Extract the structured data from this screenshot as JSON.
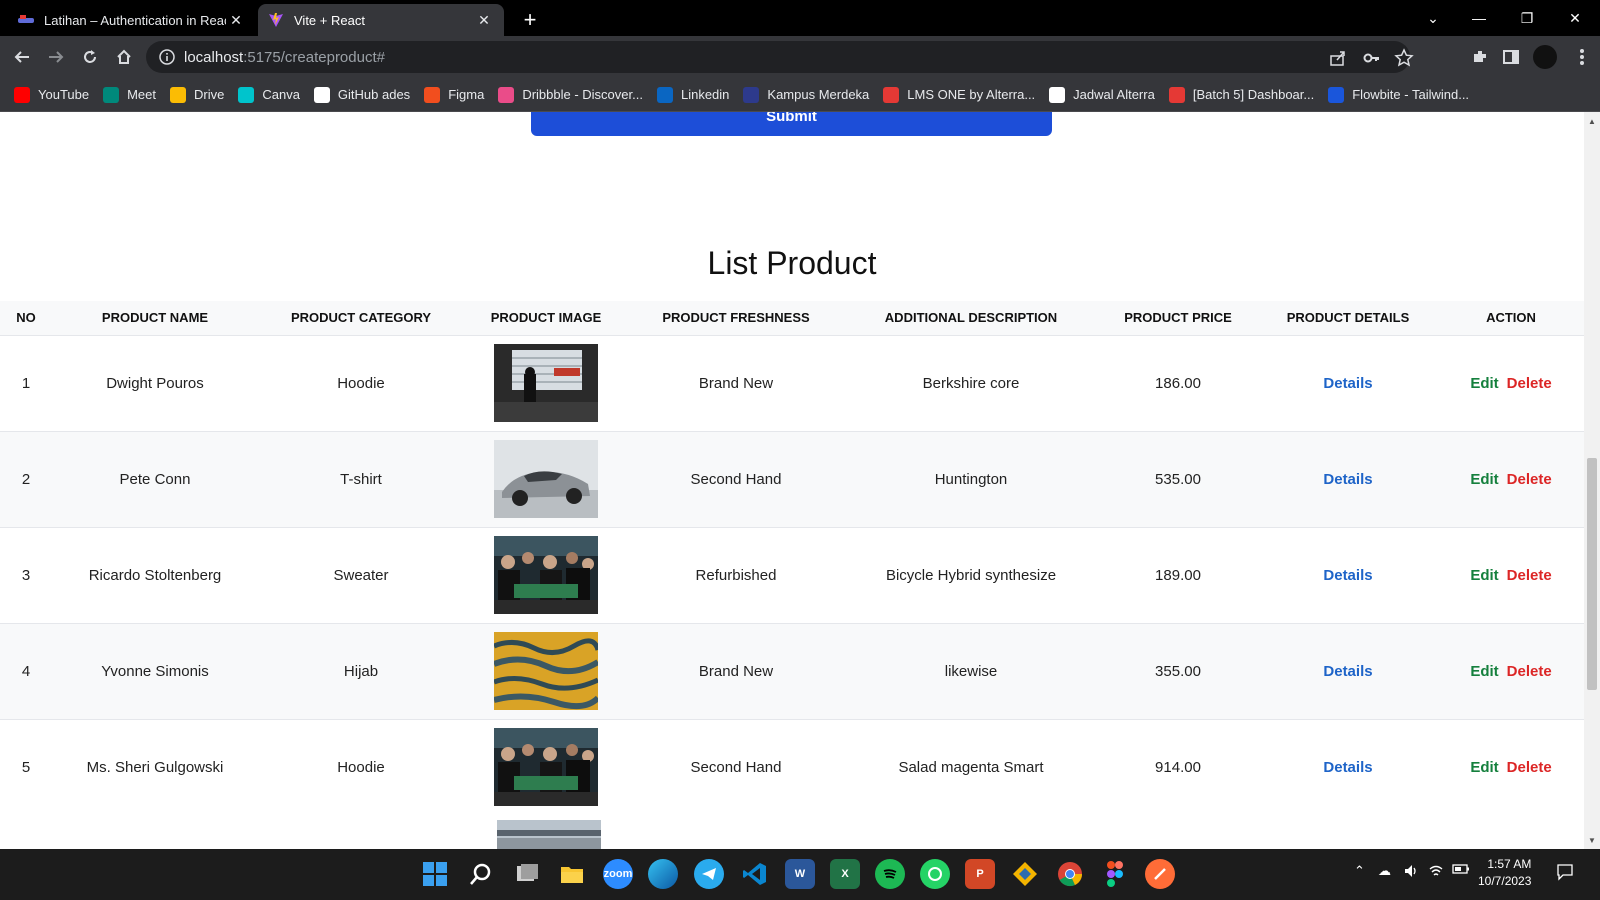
{
  "browser": {
    "tabs": [
      {
        "title": "Latihan – Authentication in React",
        "active": false
      },
      {
        "title": "Vite + React",
        "active": true
      }
    ],
    "url_host": "localhost",
    "url_path": ":5175/createproduct#",
    "bookmarks": [
      {
        "label": "YouTube",
        "icon": "youtube-icon",
        "color": "#ff0000"
      },
      {
        "label": "Meet",
        "icon": "meet-icon",
        "color": "#00897b"
      },
      {
        "label": "Drive",
        "icon": "drive-icon",
        "color": "#fbbc04"
      },
      {
        "label": "Canva",
        "icon": "canva-icon",
        "color": "#00c4cc"
      },
      {
        "label": "GitHub ades",
        "icon": "github-icon",
        "color": "#ffffff"
      },
      {
        "label": "Figma",
        "icon": "figma-icon",
        "color": "#f24e1e"
      },
      {
        "label": "Dribbble - Discover...",
        "icon": "dribbble-icon",
        "color": "#ea4c89"
      },
      {
        "label": "Linkedin",
        "icon": "linkedin-icon",
        "color": "#0a66c2"
      },
      {
        "label": "Kampus Merdeka",
        "icon": "kampus-merdeka-icon",
        "color": "#2d3a8c"
      },
      {
        "label": "LMS ONE by Alterra...",
        "icon": "lms-icon",
        "color": "#e53935"
      },
      {
        "label": "Jadwal Alterra",
        "icon": "notion-icon",
        "color": "#ffffff"
      },
      {
        "label": "[Batch 5] Dashboar...",
        "icon": "pin-icon",
        "color": "#e53935"
      },
      {
        "label": "Flowbite - Tailwind...",
        "icon": "flowbite-icon",
        "color": "#1a56db"
      }
    ]
  },
  "page": {
    "submit_label": "Submit",
    "list_title": "List Product",
    "columns": [
      "NO",
      "PRODUCT NAME",
      "PRODUCT CATEGORY",
      "PRODUCT IMAGE",
      "PRODUCT FRESHNESS",
      "ADDITIONAL DESCRIPTION",
      "PRODUCT PRICE",
      "PRODUCT DETAILS",
      "ACTION"
    ],
    "rows": [
      {
        "no": "1",
        "name": "Dwight Pouros",
        "category": "Hoodie",
        "image": "window-room-photo",
        "freshness": "Brand New",
        "description": "Berkshire core",
        "price": "186.00"
      },
      {
        "no": "2",
        "name": "Pete Conn",
        "category": "T-shirt",
        "image": "silver-car-photo",
        "freshness": "Second Hand",
        "description": "Huntington",
        "price": "535.00"
      },
      {
        "no": "3",
        "name": "Ricardo Stoltenberg",
        "category": "Sweater",
        "image": "crowd-table-photo",
        "freshness": "Refurbished",
        "description": "Bicycle Hybrid synthesize",
        "price": "189.00"
      },
      {
        "no": "4",
        "name": "Yvonne Simonis",
        "category": "Hijab",
        "image": "yellow-water-photo",
        "freshness": "Brand New",
        "description": "likewise",
        "price": "355.00"
      },
      {
        "no": "5",
        "name": "Ms. Sheri Gulgowski",
        "category": "Hoodie",
        "image": "crowd-table-photo",
        "freshness": "Second Hand",
        "description": "Salad magenta Smart",
        "price": "914.00"
      }
    ],
    "details_label": "Details",
    "edit_label": "Edit",
    "delete_label": "Delete"
  },
  "taskbar": {
    "apps": [
      "windows-start-icon",
      "search-icon",
      "task-view-icon",
      "file-explorer-icon",
      "zoom-icon",
      "edge-icon",
      "telegram-icon",
      "vscode-icon",
      "word-icon",
      "excel-icon",
      "spotify-icon",
      "whatsapp-icon",
      "powerpoint-icon",
      "git-icon",
      "chrome-icon",
      "figma-icon",
      "postman-icon"
    ],
    "zoom_label": "zoom",
    "time": "1:57 AM",
    "date": "10/7/2023"
  }
}
